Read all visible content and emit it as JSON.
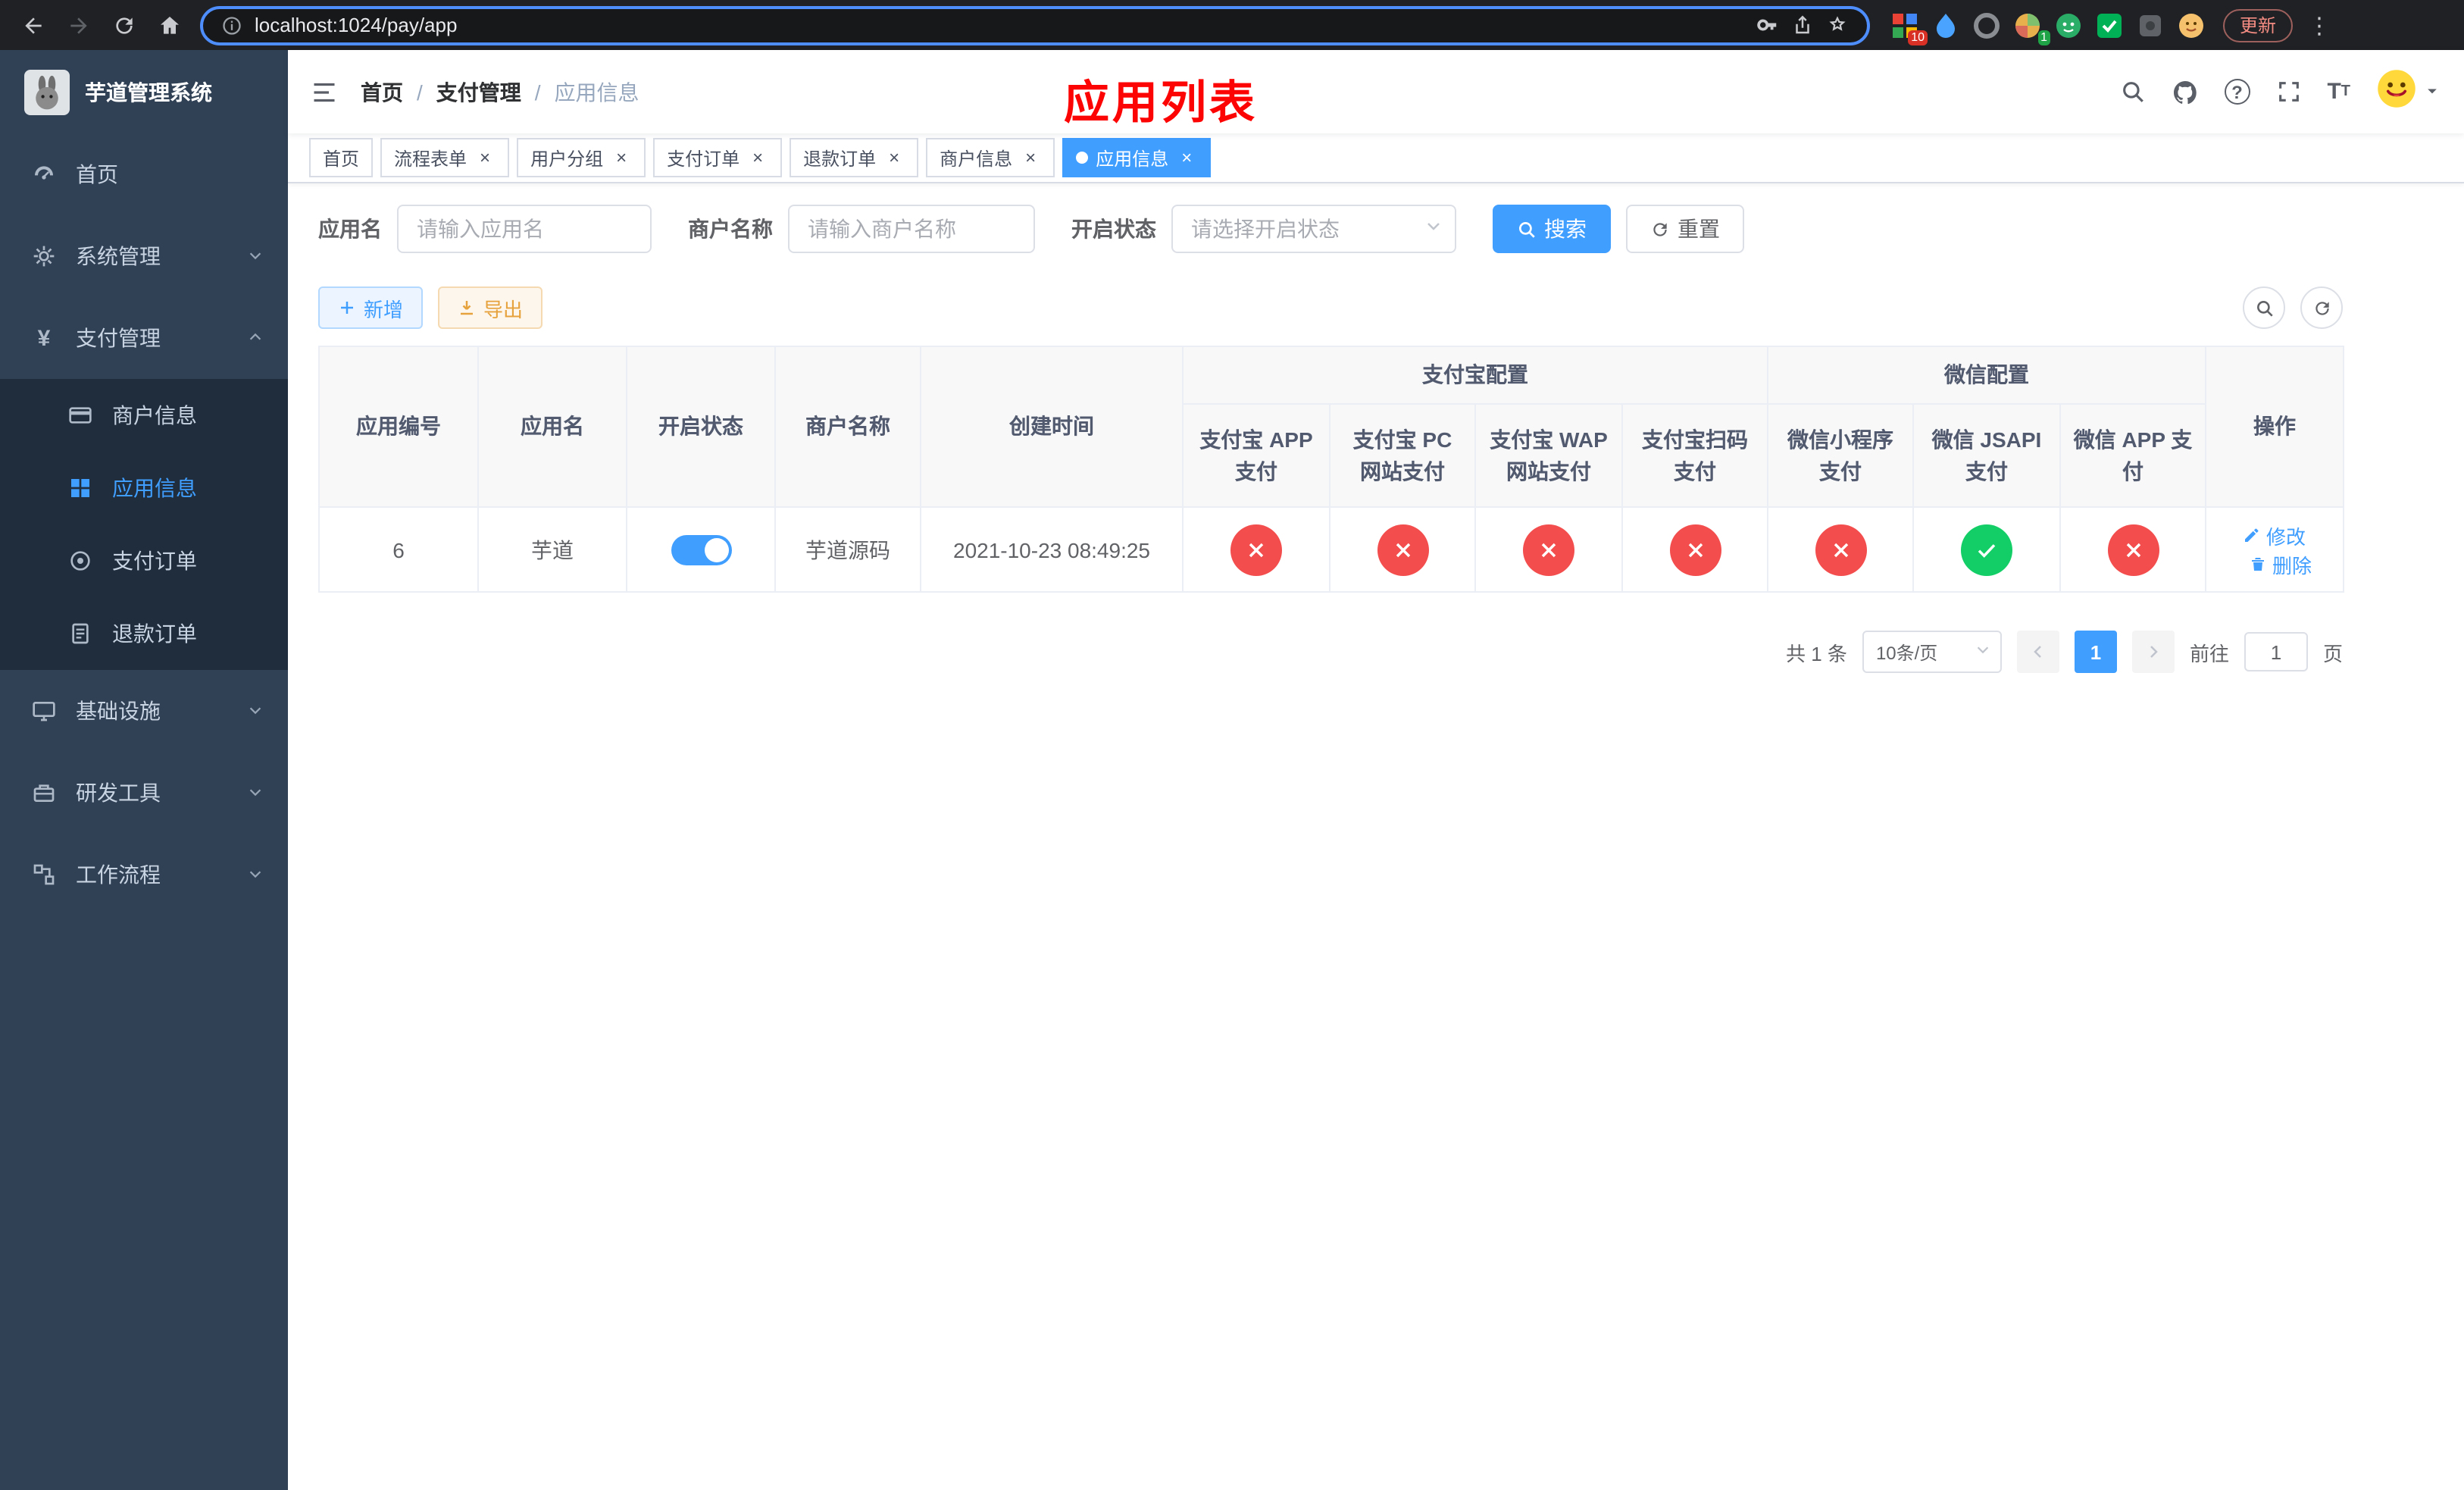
{
  "browser": {
    "url": "localhost:1024/pay/app",
    "update_button": "更新",
    "ext_badge_a": "10",
    "ext_badge_b": "1",
    "menu_glyph": "⋮"
  },
  "sidebar": {
    "app_title": "芋道管理系统",
    "menu": {
      "home": "首页",
      "system": "系统管理",
      "payment": "支付管理",
      "merchant_info": "商户信息",
      "app_info": "应用信息",
      "pay_order": "支付订单",
      "refund_order": "退款订单",
      "infrastructure": "基础设施",
      "dev_tools": "研发工具",
      "workflow": "工作流程"
    }
  },
  "header": {
    "breadcrumb": [
      "首页",
      "支付管理",
      "应用信息"
    ],
    "breadcrumb_separator": "/",
    "annotation": "应用列表"
  },
  "tabs_meta": {
    "close_glyph": "×"
  },
  "tabs": [
    {
      "label": "首页",
      "closable": false,
      "active": false
    },
    {
      "label": "流程表单",
      "closable": true,
      "active": false
    },
    {
      "label": "用户分组",
      "closable": true,
      "active": false
    },
    {
      "label": "支付订单",
      "closable": true,
      "active": false
    },
    {
      "label": "退款订单",
      "closable": true,
      "active": false
    },
    {
      "label": "商户信息",
      "closable": true,
      "active": false
    },
    {
      "label": "应用信息",
      "closable": true,
      "active": true
    }
  ],
  "filter": {
    "app_name_label": "应用名",
    "app_name_placeholder": "请输入应用名",
    "merchant_label": "商户名称",
    "merchant_placeholder": "请输入商户名称",
    "status_label": "开启状态",
    "status_placeholder": "请选择开启状态",
    "search_button": "搜索",
    "reset_button": "重置"
  },
  "toolbar": {
    "add_button": "新增",
    "export_button": "导出"
  },
  "table": {
    "headers": {
      "app_id": "应用编号",
      "app_name": "应用名",
      "enabled": "开启状态",
      "merchant_name": "商户名称",
      "create_time": "创建时间",
      "alipay_group": "支付宝配置",
      "wechat_group": "微信配置",
      "alipay_app": "支付宝 APP 支付",
      "alipay_pc": "支付宝 PC 网站支付",
      "alipay_wap": "支付宝 WAP 网站支付",
      "alipay_qr": "支付宝扫码支付",
      "wx_mini": "微信小程序支付",
      "wx_jsapi": "微信 JSAPI 支付",
      "wx_app": "微信 APP 支付",
      "actions": "操作"
    },
    "row": {
      "app_id": "6",
      "app_name": "芋道",
      "enabled": true,
      "merchant_name": "芋道源码",
      "create_time": "2021-10-23 08:49:25",
      "statuses": [
        "no",
        "no",
        "no",
        "no",
        "no",
        "yes",
        "no"
      ],
      "edit_label": "修改",
      "delete_label": "删除"
    }
  },
  "pagination": {
    "total": "共 1 条",
    "page_size": "10条/页",
    "page": "1",
    "goto_label": "前往",
    "goto_value": "1",
    "page_unit": "页"
  },
  "colors": {
    "accent": "#409EFF",
    "danger": "#f34d4d",
    "success": "#13ce66",
    "annotation_red": "#fd0404",
    "sidebar_bg": "#304156",
    "submenu_bg": "#1f2d3d"
  }
}
